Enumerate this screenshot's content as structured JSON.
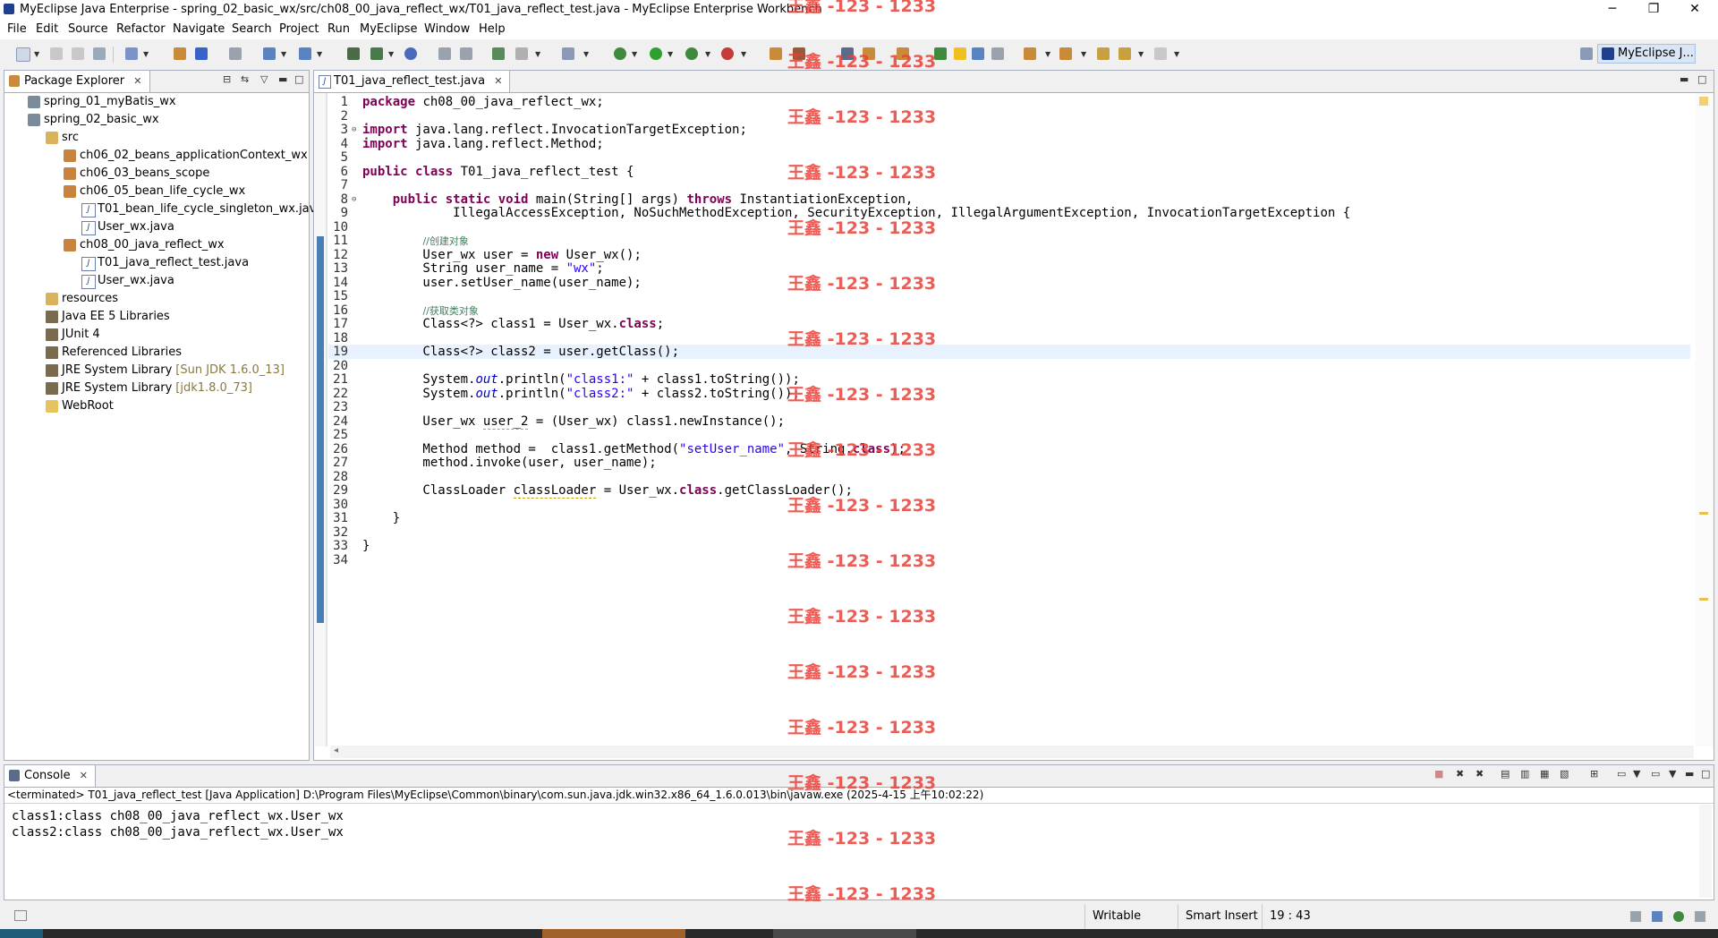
{
  "window": {
    "title": "MyEclipse Java Enterprise - spring_02_basic_wx/src/ch08_00_java_reflect_wx/T01_java_reflect_test.java - MyEclipse Enterprise Workbench",
    "minimize": "─",
    "restore": "❐",
    "close": "✕"
  },
  "menu": [
    "File",
    "Edit",
    "Source",
    "Refactor",
    "Navigate",
    "Search",
    "Project",
    "Run",
    "MyEclipse",
    "Window",
    "Help"
  ],
  "perspective": {
    "label": "MyEclipse J..."
  },
  "package_explorer": {
    "title": "Package Explorer",
    "tree": [
      {
        "label": "spring_01_myBatis_wx",
        "icon": "project-icon",
        "level": 0
      },
      {
        "label": "spring_02_basic_wx",
        "icon": "project-icon",
        "level": 0
      },
      {
        "label": "src",
        "icon": "source-folder-icon",
        "level": 1
      },
      {
        "label": "ch06_02_beans_applicationContext_wx",
        "icon": "package-icon",
        "level": 2
      },
      {
        "label": "ch06_03_beans_scope",
        "icon": "package-icon",
        "level": 2
      },
      {
        "label": "ch06_05_bean_life_cycle_wx",
        "icon": "package-icon",
        "level": 2
      },
      {
        "label": "T01_bean_life_cycle_singleton_wx.java",
        "icon": "java-file-icon",
        "level": 3
      },
      {
        "label": "User_wx.java",
        "icon": "java-file-icon",
        "level": 3
      },
      {
        "label": "ch08_00_java_reflect_wx",
        "icon": "package-icon",
        "level": 2
      },
      {
        "label": "T01_java_reflect_test.java",
        "icon": "java-file-icon",
        "level": 3,
        "selected": true
      },
      {
        "label": "User_wx.java",
        "icon": "java-file-icon",
        "level": 3
      },
      {
        "label": "resources",
        "icon": "source-folder-icon",
        "level": 1
      },
      {
        "label": "Java EE 5 Libraries",
        "icon": "library-icon",
        "level": 1
      },
      {
        "label": "JUnit 4",
        "icon": "library-icon",
        "level": 1
      },
      {
        "label": "Referenced Libraries",
        "icon": "library-icon",
        "level": 1
      },
      {
        "label": "JRE System Library",
        "decoration": "[Sun JDK 1.6.0_13]",
        "icon": "library-icon",
        "level": 1
      },
      {
        "label": "JRE System Library",
        "decoration": "[jdk1.8.0_73]",
        "icon": "library-icon",
        "level": 1
      },
      {
        "label": "WebRoot",
        "icon": "folder-icon",
        "level": 1
      }
    ]
  },
  "editor": {
    "tab_label": "T01_java_reflect_test.java",
    "current_line": 19,
    "lines": [
      "package ch08_00_java_reflect_wx;",
      "",
      "import java.lang.reflect.InvocationTargetException;",
      "import java.lang.reflect.Method;",
      "",
      "public class T01_java_reflect_test {",
      "",
      "    public static void main(String[] args) throws InstantiationException,",
      "            IllegalAccessException, NoSuchMethodException, SecurityException, IllegalArgumentException, InvocationTargetException {",
      "",
      "        //创建对象",
      "        User_wx user = new User_wx();",
      "        String user_name = \"wx\";",
      "        user.setUser_name(user_name);",
      "",
      "        //获取类对象",
      "        Class<?> class1 = User_wx.class;",
      "",
      "        Class<?> class2 = user.getClass();",
      "",
      "        System.out.println(\"class1:\" + class1.toString());",
      "        System.out.println(\"class2:\" + class2.toString());",
      "",
      "        User_wx user_2 = (User_wx) class1.newInstance();",
      "",
      "        Method method =  class1.getMethod(\"setUser_name\", String.class);",
      "        method.invoke(user, user_name);",
      "",
      "        ClassLoader classLoader = User_wx.class.getClassLoader();",
      "",
      "    }",
      "",
      "}",
      ""
    ]
  },
  "watermark": "王鑫 -123 - 1233",
  "console": {
    "title": "Console",
    "header": "<terminated> T01_java_reflect_test [Java Application] D:\\Program Files\\MyEclipse\\Common\\binary\\com.sun.java.jdk.win32.x86_64_1.6.0.013\\bin\\javaw.exe (2025-4-15 上午10:02:22)",
    "output": [
      "class1:class ch08_00_java_reflect_wx.User_wx",
      "class2:class ch08_00_java_reflect_wx.User_wx"
    ]
  },
  "status": {
    "writable": "Writable",
    "insert_mode": "Smart Insert",
    "position": "19 : 43"
  }
}
